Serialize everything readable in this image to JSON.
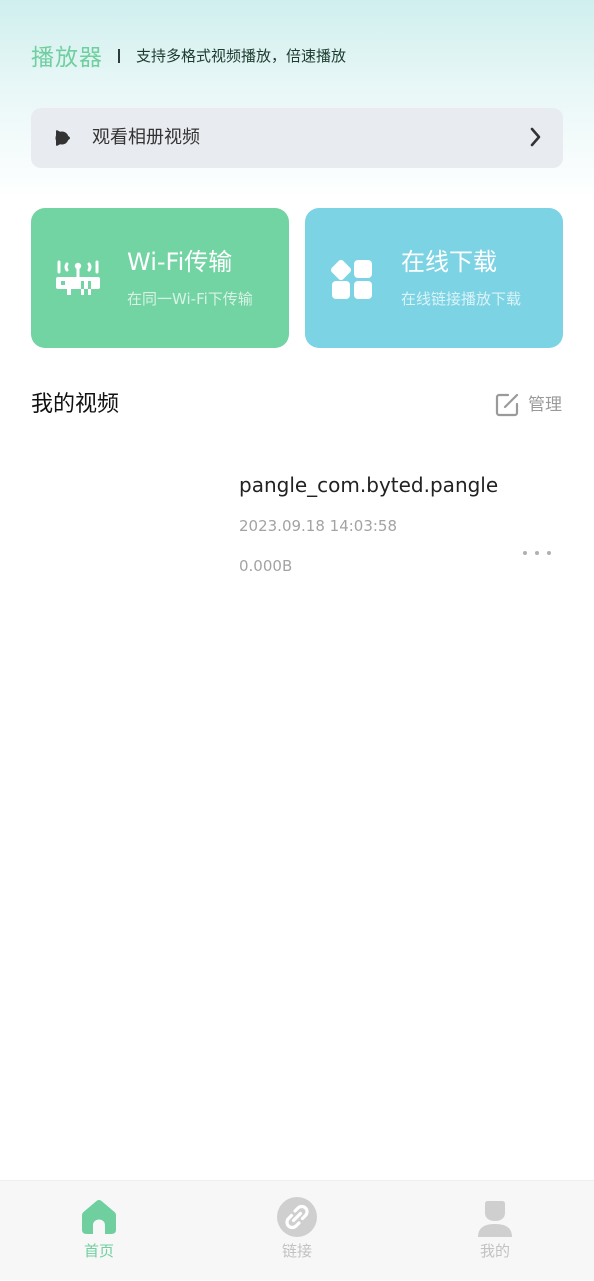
{
  "header": {
    "app_title": "播放器",
    "subtitle": "支持多格式视频播放，倍速播放"
  },
  "album_entry": {
    "label": "观看相册视频",
    "icon": "play-bubble-icon",
    "trailing_icon": "chevron-right-icon"
  },
  "cards": [
    {
      "title": "Wi-Fi传输",
      "subtitle": "在同一Wi-Fi下传输",
      "icon": "router-icon",
      "color": "#72d3a3"
    },
    {
      "title": "在线下载",
      "subtitle": "在线链接播放下载",
      "icon": "apps-grid-icon",
      "color": "#7cd3e4"
    }
  ],
  "my_videos": {
    "title": "我的视频",
    "manage_label": "管理",
    "items": [
      {
        "name": "pangle_com.byted.pangle",
        "date": "2023.09.18 14:03:58",
        "size": "0.000B"
      }
    ]
  },
  "bottom_nav": {
    "items": [
      {
        "label": "首页",
        "icon": "home-icon",
        "active": true
      },
      {
        "label": "链接",
        "icon": "link-icon",
        "active": false
      },
      {
        "label": "我的",
        "icon": "user-icon",
        "active": false
      }
    ]
  },
  "colors": {
    "accent": "#6fcf9f",
    "wifi_card": "#72d3a3",
    "download_card": "#7cd3e4",
    "inactive_nav": "#c2c2c2"
  }
}
